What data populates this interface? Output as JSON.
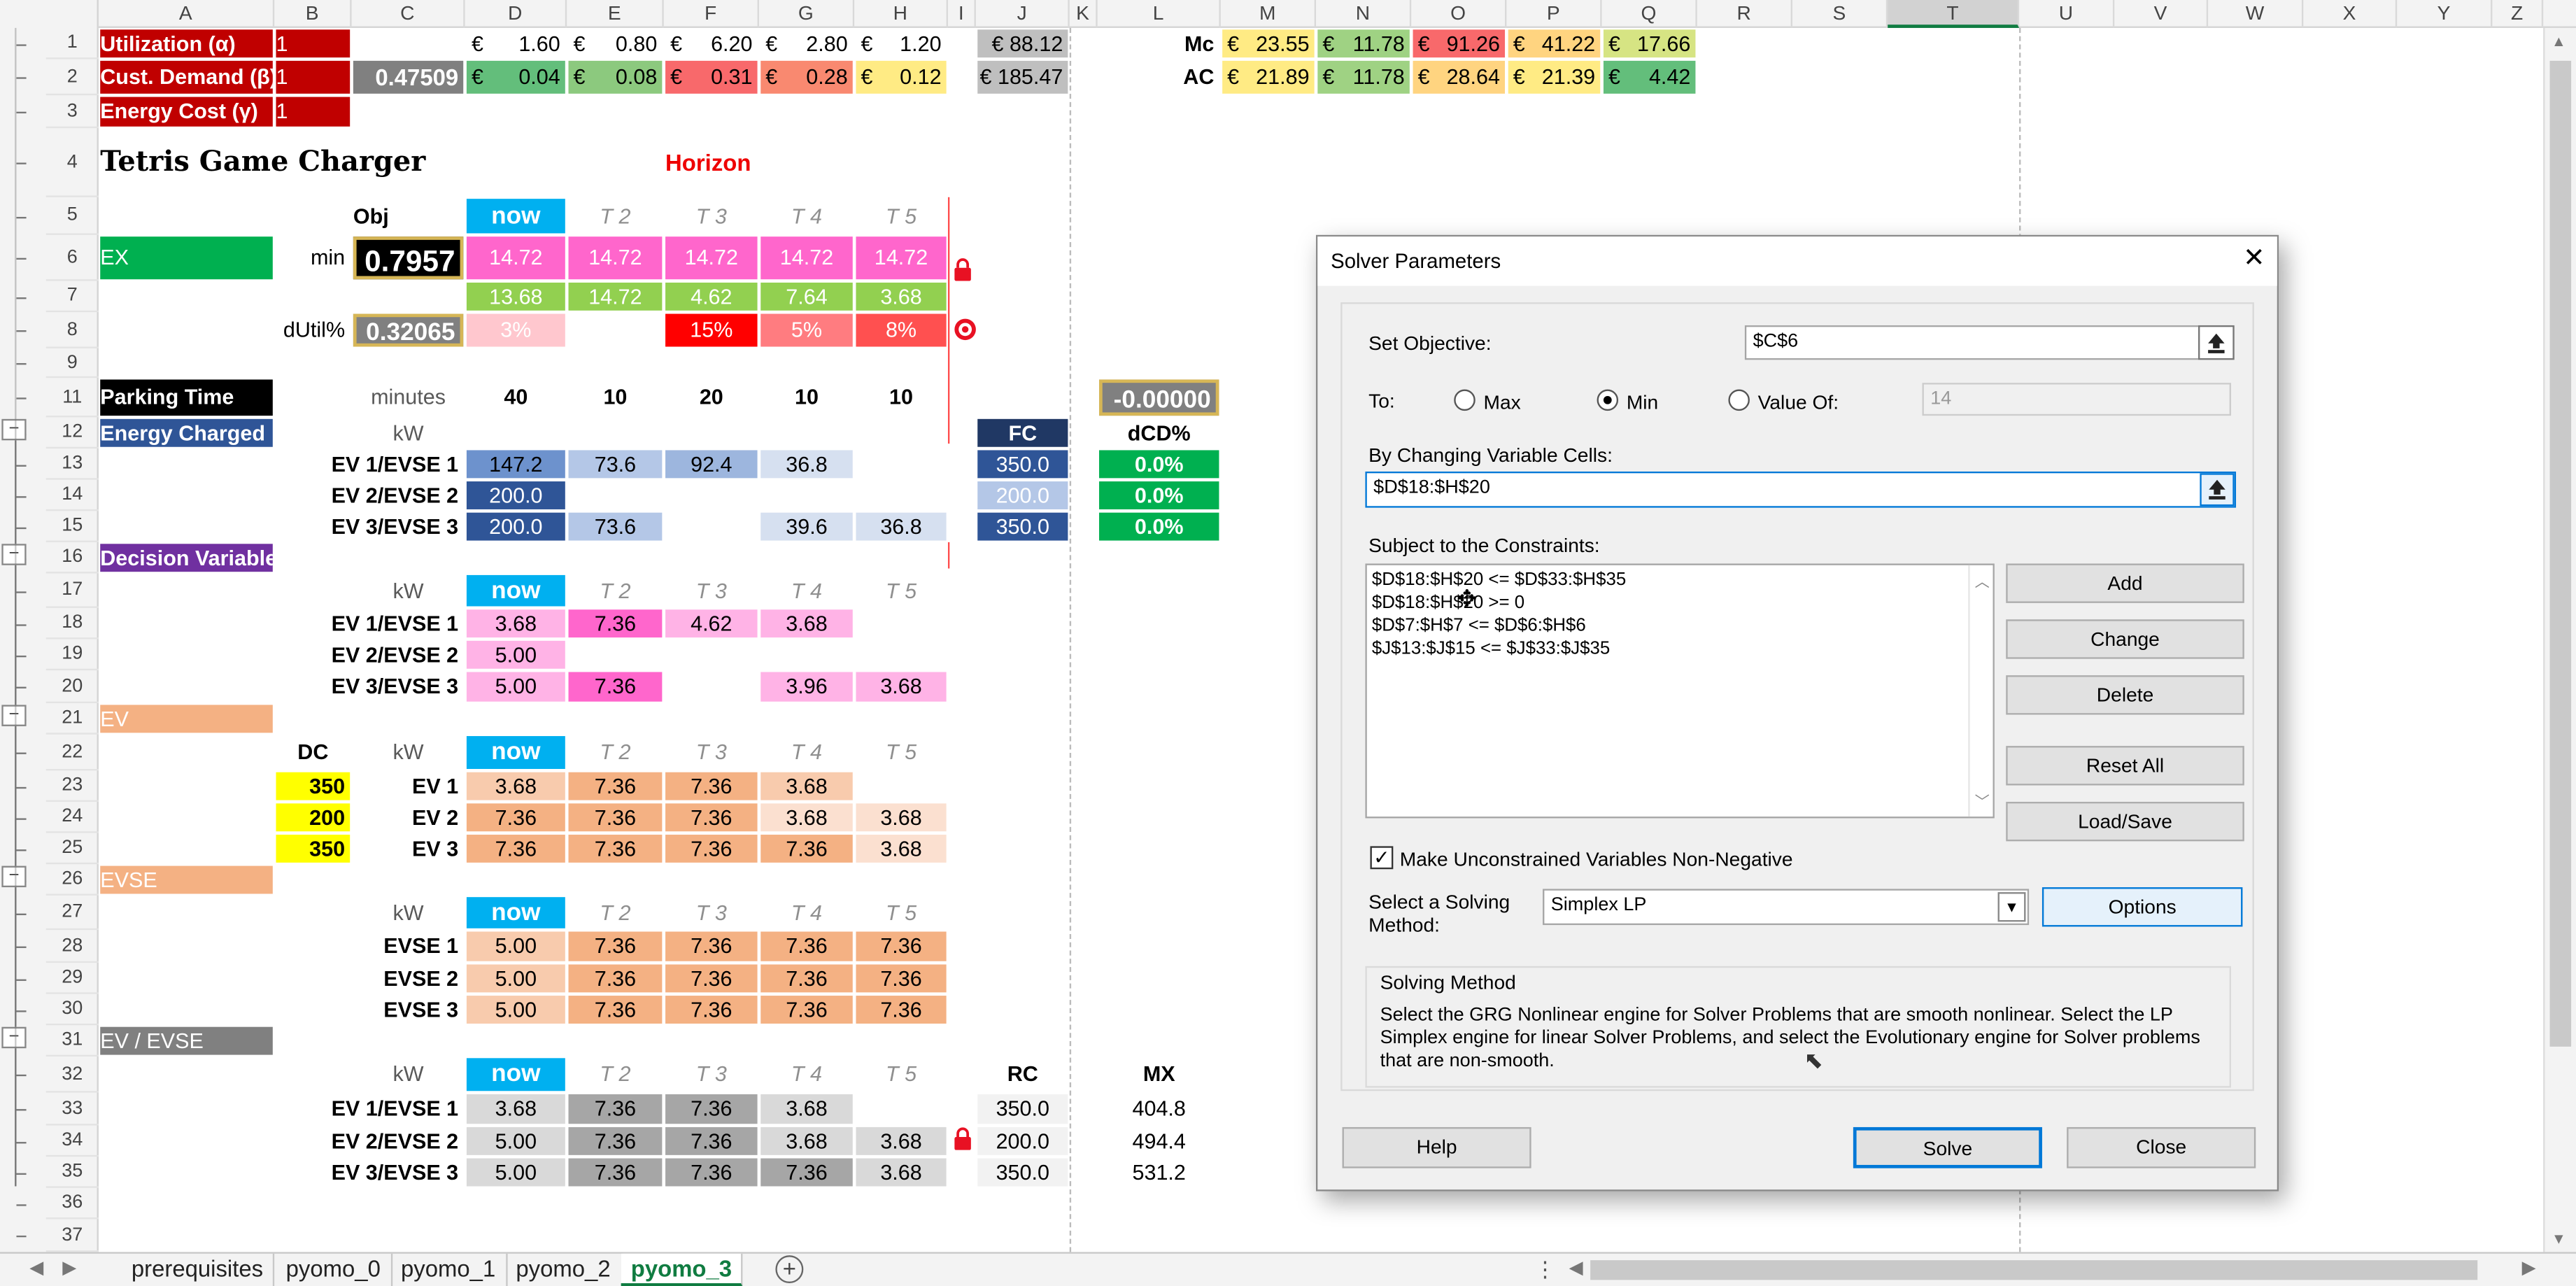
{
  "columns": [
    "A",
    "B",
    "C",
    "D",
    "E",
    "F",
    "G",
    "H",
    "I",
    "J",
    "K",
    "L",
    "M",
    "N",
    "O",
    "P",
    "Q",
    "R",
    "S",
    "T",
    "U",
    "V",
    "W",
    "X",
    "Y",
    "Z"
  ],
  "outline_levels": [
    "1",
    "2"
  ],
  "rows": [
    "1",
    "2",
    "3",
    "4",
    "5",
    "6",
    "7",
    "8",
    "9",
    "11",
    "12",
    "13",
    "14",
    "15",
    "16",
    "17",
    "18",
    "19",
    "20",
    "21",
    "22",
    "23",
    "24",
    "25",
    "26",
    "27",
    "28",
    "29",
    "30",
    "31",
    "32",
    "33",
    "34",
    "35",
    "36",
    "37"
  ],
  "top": {
    "r1": {
      "label": "Utilization (α)",
      "b": "1",
      "cur": "€",
      "vals": [
        "1.60",
        "0.80",
        "6.20",
        "2.80",
        "1.20"
      ],
      "j": "€  88.12"
    },
    "r2": {
      "label": "Cust. Demand (β)",
      "b": "1",
      "c": "0.47509",
      "cur": "€",
      "vals": [
        "0.04",
        "0.08",
        "0.31",
        "0.28",
        "0.12"
      ],
      "j": "€ 185.47"
    },
    "r3": {
      "label": "Energy Cost (γ)",
      "b": "1"
    },
    "mc": {
      "label": "Mc",
      "vals": [
        "23.55",
        "11.78",
        "91.26",
        "41.22",
        "17.66"
      ]
    },
    "ac": {
      "label": "AC",
      "vals": [
        "21.89",
        "11.78",
        "28.64",
        "21.39",
        "4.42"
      ]
    }
  },
  "sheet": {
    "title": "Tetris Game Charger",
    "horizon": "Horizon",
    "obj": "Obj",
    "now": "now",
    "periods": [
      "T 2",
      "T 3",
      "T 4",
      "T 5"
    ],
    "ex": "EX",
    "min": "min",
    "obj_value": "0.7957",
    "r6": [
      "14.72",
      "14.72",
      "14.72",
      "14.72",
      "14.72"
    ],
    "r7": [
      "13.68",
      "14.72",
      "4.62",
      "7.64",
      "3.68"
    ],
    "dutil": "dUtil%",
    "dutil_value": "0.32065",
    "r8": [
      "3%",
      "15%",
      "5%",
      "8%"
    ],
    "parking": "Parking Time",
    "minutes": "minutes",
    "r11": [
      "40",
      "10",
      "20",
      "10",
      "10"
    ],
    "l11": "-0.00000",
    "energy": "Energy Charged",
    "kw": "kW",
    "fc": "FC",
    "dcd": "dCD%",
    "ev_evse": [
      "EV 1/EVSE 1",
      "EV 2/EVSE 2",
      "EV 3/EVSE 3"
    ],
    "r13": [
      "147.2",
      "73.6",
      "92.4",
      "36.8"
    ],
    "r14": [
      "200.0"
    ],
    "r15": [
      "200.0",
      "73.6",
      "39.6",
      "36.8"
    ],
    "fcvals": [
      "350.0",
      "200.0",
      "350.0"
    ],
    "dcdvals": [
      "0.0%",
      "0.0%",
      "0.0%"
    ],
    "decision": "Decision Variables",
    "r18": [
      "3.68",
      "7.36",
      "4.62",
      "3.68"
    ],
    "r19": [
      "5.00"
    ],
    "r20": [
      "5.00",
      "7.36",
      "3.96",
      "3.68"
    ],
    "ev": "EV",
    "dc": "DC",
    "dcvals": [
      "350",
      "200",
      "350"
    ],
    "evs": [
      "EV 1",
      "EV 2",
      "EV 3"
    ],
    "r23": [
      "3.68",
      "7.36",
      "7.36",
      "3.68"
    ],
    "r24": [
      "7.36",
      "7.36",
      "7.36",
      "3.68",
      "3.68"
    ],
    "r25": [
      "7.36",
      "7.36",
      "7.36",
      "7.36",
      "3.68"
    ],
    "evse": "EVSE",
    "evses": [
      "EVSE 1",
      "EVSE 2",
      "EVSE 3"
    ],
    "r28": [
      "5.00",
      "7.36",
      "7.36",
      "7.36",
      "7.36"
    ],
    "r29": [
      "5.00",
      "7.36",
      "7.36",
      "7.36",
      "7.36"
    ],
    "r30": [
      "5.00",
      "7.36",
      "7.36",
      "7.36",
      "7.36"
    ],
    "evevse": "EV / EVSE",
    "rc": "RC",
    "mx": "MX",
    "r33": [
      "3.68",
      "7.36",
      "7.36",
      "3.68"
    ],
    "r34": [
      "5.00",
      "7.36",
      "7.36",
      "3.68",
      "3.68"
    ],
    "r35": [
      "5.00",
      "7.36",
      "7.36",
      "7.36",
      "3.68"
    ],
    "rcvals": [
      "350.0",
      "200.0",
      "350.0"
    ],
    "mxvals": [
      "404.8",
      "494.4",
      "531.2"
    ]
  },
  "dialog": {
    "title": "Solver Parameters",
    "set_objective": "Set Objective:",
    "objective": "$C$6",
    "to": "To:",
    "max": "Max",
    "min": "Min",
    "value_of": "Value Of:",
    "value": "14",
    "changing": "By Changing Variable Cells:",
    "changing_value": "$D$18:$H$20",
    "subject": "Subject to the Constraints:",
    "constraints": [
      "$D$18:$H$20 <= $D$33:$H$35",
      "$D$18:$H$20 >= 0",
      "$D$7:$H$7 <= $D$6:$H$6",
      "$J$13:$J$15 <= $J$33:$J$35"
    ],
    "add": "Add",
    "change": "Change",
    "delete": "Delete",
    "reset": "Reset All",
    "loadsave": "Load/Save",
    "nonneg": "Make Unconstrained Variables Non-Negative",
    "select_method": "Select a Solving Method:",
    "method": "Simplex LP",
    "options": "Options",
    "solving_method": "Solving Method",
    "desc": "Select the GRG Nonlinear engine for Solver Problems that are smooth nonlinear. Select the LP Simplex engine for linear Solver Problems, and select the Evolutionary engine for Solver problems that are non-smooth.",
    "help": "Help",
    "solve": "Solve",
    "close": "Close"
  },
  "tabs": [
    "prerequisites",
    "pyomo_0",
    "pyomo_1",
    "pyomo_2",
    "pyomo_3"
  ],
  "colors": {
    "red": "#c00000",
    "green": "#00b050",
    "blue": "#2f5597",
    "purple": "#7030a0",
    "orange": "#f4b183",
    "gray": "#808080",
    "cyan": "#00b0f0",
    "pink": "#ff66cc",
    "yellow": "#ffff00"
  }
}
